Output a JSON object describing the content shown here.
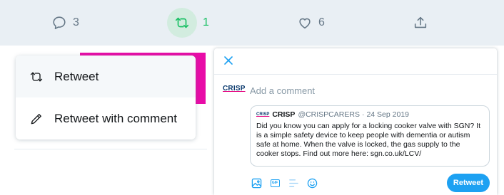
{
  "action_bar": {
    "reply": {
      "icon": "reply-icon",
      "count": "3"
    },
    "retweet": {
      "icon": "retweet-icon",
      "count": "1",
      "active": true,
      "color": "#17bf63"
    },
    "like": {
      "icon": "heart-icon",
      "count": "6"
    },
    "share": {
      "icon": "share-icon"
    }
  },
  "retweet_menu": {
    "items": [
      {
        "icon": "retweet-icon",
        "label": "Retweet"
      },
      {
        "icon": "pencil-icon",
        "label": "Retweet with comment"
      }
    ]
  },
  "modal": {
    "close_icon": "close-icon",
    "avatar_text": "CRISP",
    "comment_placeholder": "Add a comment",
    "quoted_tweet": {
      "logo_text": "CRISP",
      "name": "CRISP",
      "handle": "@CRISPCARERS",
      "separator": "·",
      "date": "24 Sep 2019",
      "text": "Did you know you can apply for a locking cooker valve with SGN? It is a simple safety device to keep people with dementia or autism safe at home. When the valve is locked, the gas supply to the cooker stops. Find out more here:  sgn.co.uk/LCV/"
    },
    "toolbar": {
      "icons": [
        "image-icon",
        "gif-icon",
        "poll-icon",
        "emoji-icon"
      ],
      "gif_label": "GIF"
    },
    "submit_label": "Retweet"
  },
  "colors": {
    "accent": "#1da1f2",
    "retweet_green": "#17bf63",
    "brand_magenta": "#e80ca7",
    "action_bar_bg": "#e9eff4"
  }
}
